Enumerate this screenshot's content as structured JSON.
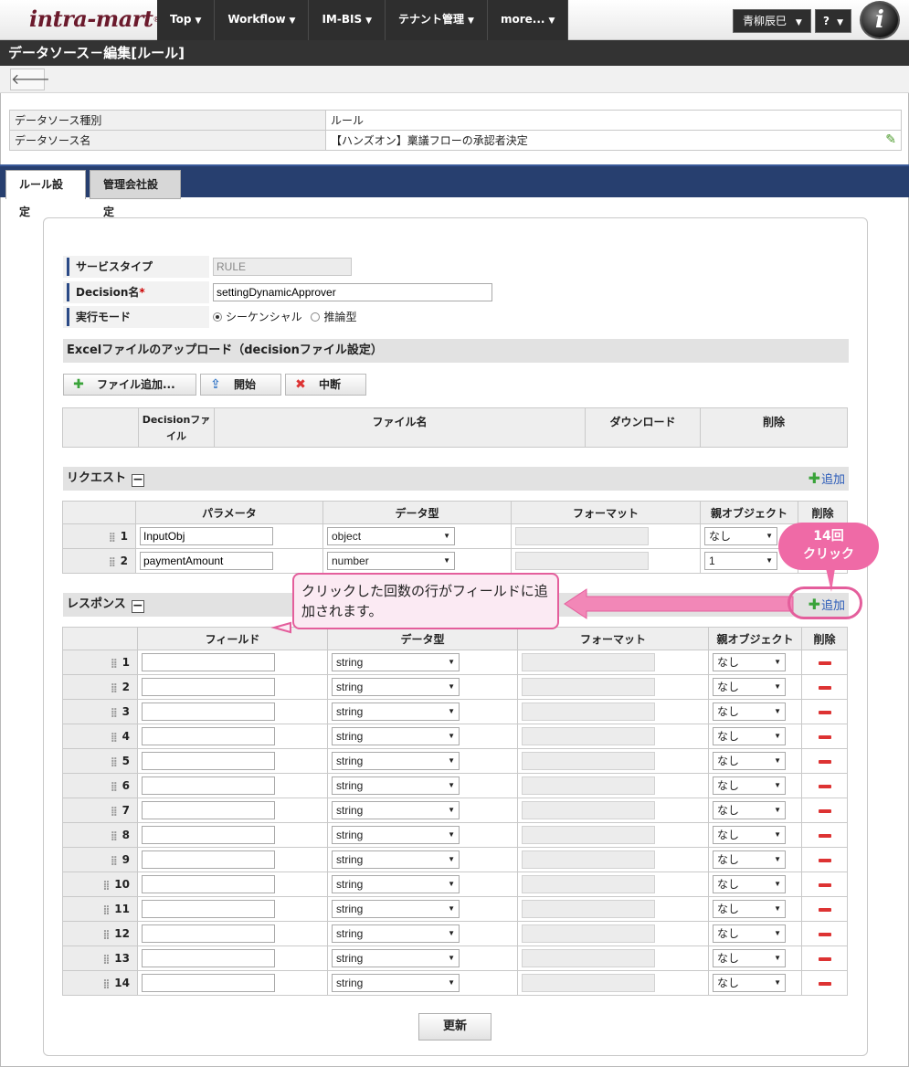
{
  "header": {
    "logo": "intra-mart",
    "menu": [
      {
        "label": "Top"
      },
      {
        "label": "Workflow"
      },
      {
        "label": "IM-BIS"
      },
      {
        "label": "テナント管理"
      },
      {
        "label": "more..."
      }
    ],
    "user": "青柳辰巳",
    "help": "?"
  },
  "page_title": "データソース－編集[ルール]",
  "info": {
    "rows": [
      {
        "label": "データソース種別",
        "value": "ルール"
      },
      {
        "label": "データソース名",
        "value": "【ハンズオン】稟議フローの承認者決定"
      }
    ]
  },
  "tabs": [
    "ルール設定",
    "管理会社設定"
  ],
  "form": {
    "service_type_label": "サービスタイプ",
    "service_type_value": "RULE",
    "decision_label": "Decision名",
    "decision_required": "*",
    "decision_value": "settingDynamicApprover",
    "mode_label": "実行モード",
    "mode_options": [
      "シーケンシャル",
      "推論型"
    ]
  },
  "excel": {
    "title": "Excelファイルのアップロード（decisionファイル設定）",
    "buttons": [
      "ファイル追加...",
      "開始",
      "中断"
    ],
    "headers": [
      "Decisionファイル",
      "ファイル名",
      "ダウンロード",
      "削除"
    ]
  },
  "request": {
    "title": "リクエスト",
    "add": "追加",
    "headers": [
      "パラメータ",
      "データ型",
      "フォーマット",
      "親オブジェクト",
      "削除"
    ],
    "rows": [
      {
        "no": "1",
        "param": "InputObj",
        "type": "object",
        "parent": "なし"
      },
      {
        "no": "2",
        "param": "paymentAmount",
        "type": "number",
        "parent": "1"
      }
    ]
  },
  "response": {
    "title": "レスポンス",
    "add": "追加",
    "headers": [
      "フィールド",
      "データ型",
      "フォーマット",
      "親オブジェクト",
      "削除"
    ],
    "rows": [
      {
        "no": "1",
        "type": "string",
        "parent": "なし"
      },
      {
        "no": "2",
        "type": "string",
        "parent": "なし"
      },
      {
        "no": "3",
        "type": "string",
        "parent": "なし"
      },
      {
        "no": "4",
        "type": "string",
        "parent": "なし"
      },
      {
        "no": "5",
        "type": "string",
        "parent": "なし"
      },
      {
        "no": "6",
        "type": "string",
        "parent": "なし"
      },
      {
        "no": "7",
        "type": "string",
        "parent": "なし"
      },
      {
        "no": "8",
        "type": "string",
        "parent": "なし"
      },
      {
        "no": "9",
        "type": "string",
        "parent": "なし"
      },
      {
        "no": "10",
        "type": "string",
        "parent": "なし"
      },
      {
        "no": "11",
        "type": "string",
        "parent": "なし"
      },
      {
        "no": "12",
        "type": "string",
        "parent": "なし"
      },
      {
        "no": "13",
        "type": "string",
        "parent": "なし"
      },
      {
        "no": "14",
        "type": "string",
        "parent": "なし"
      }
    ]
  },
  "update_button": "更新",
  "annotations": {
    "callout": "クリックした回数の行がフィールドに追加されます。",
    "bubble_line1": "14回",
    "bubble_line2": "クリック"
  },
  "colors": {
    "nav_dark": "#2e2e2e",
    "tab_bar": "#273f6f",
    "annotation_pink": "#e45e9c",
    "add_link": "#2b5bb8"
  }
}
